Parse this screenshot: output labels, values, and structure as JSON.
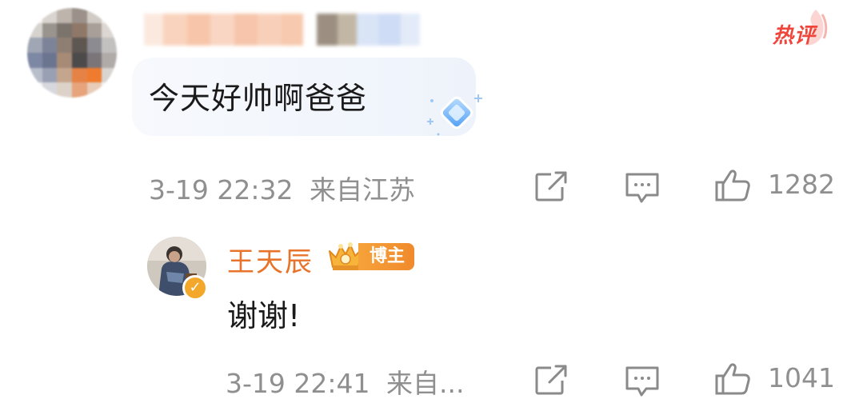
{
  "hot_badge": "热评",
  "comment": {
    "text": "今天好帅啊爸爸",
    "time": "3-19 22:32",
    "location": "来自江苏",
    "like_count": "1282"
  },
  "reply": {
    "author": "王天辰",
    "badge": "博主",
    "text": "谢谢!",
    "time": "3-19 22:41",
    "location": "来自...",
    "like_count": "1041"
  },
  "colors": {
    "accent_orange": "#e8742c",
    "hot_red": "#f0453b",
    "meta_gray": "#8f8f8f",
    "bubble_bg": "#eef3fb"
  },
  "icons": {
    "share": "share-icon",
    "comment": "comment-icon",
    "like": "thumbs-up-icon",
    "crown": "crown-icon",
    "verified": "verified-badge-icon"
  }
}
